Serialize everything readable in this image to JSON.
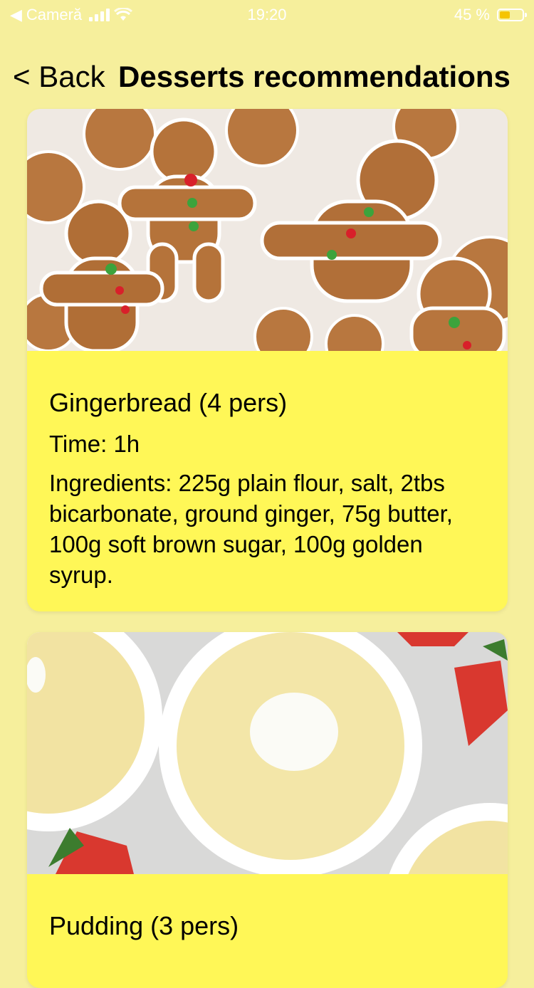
{
  "status_bar": {
    "carrier": "Cameră",
    "time": "19:20",
    "battery_text": "45 %",
    "battery_level": 0.45
  },
  "nav": {
    "back_label": "< Back",
    "title": "Desserts recommendations"
  },
  "recipes": [
    {
      "title": "Gingerbread (4 pers)",
      "time": "Time: 1h",
      "ingredients": " Ingredients: 225g plain flour, salt, 2tbs bicarbonate, ground ginger, 75g butter, 100g soft brown sugar, 100g golden syrup.",
      "image_icon": "gingerbread-photo"
    },
    {
      "title": "Pudding (3 pers)",
      "image_icon": "pudding-photo"
    }
  ],
  "colors": {
    "background": "#f6ef9c",
    "card": "#fff757",
    "battery_fill": "#f5c400"
  }
}
